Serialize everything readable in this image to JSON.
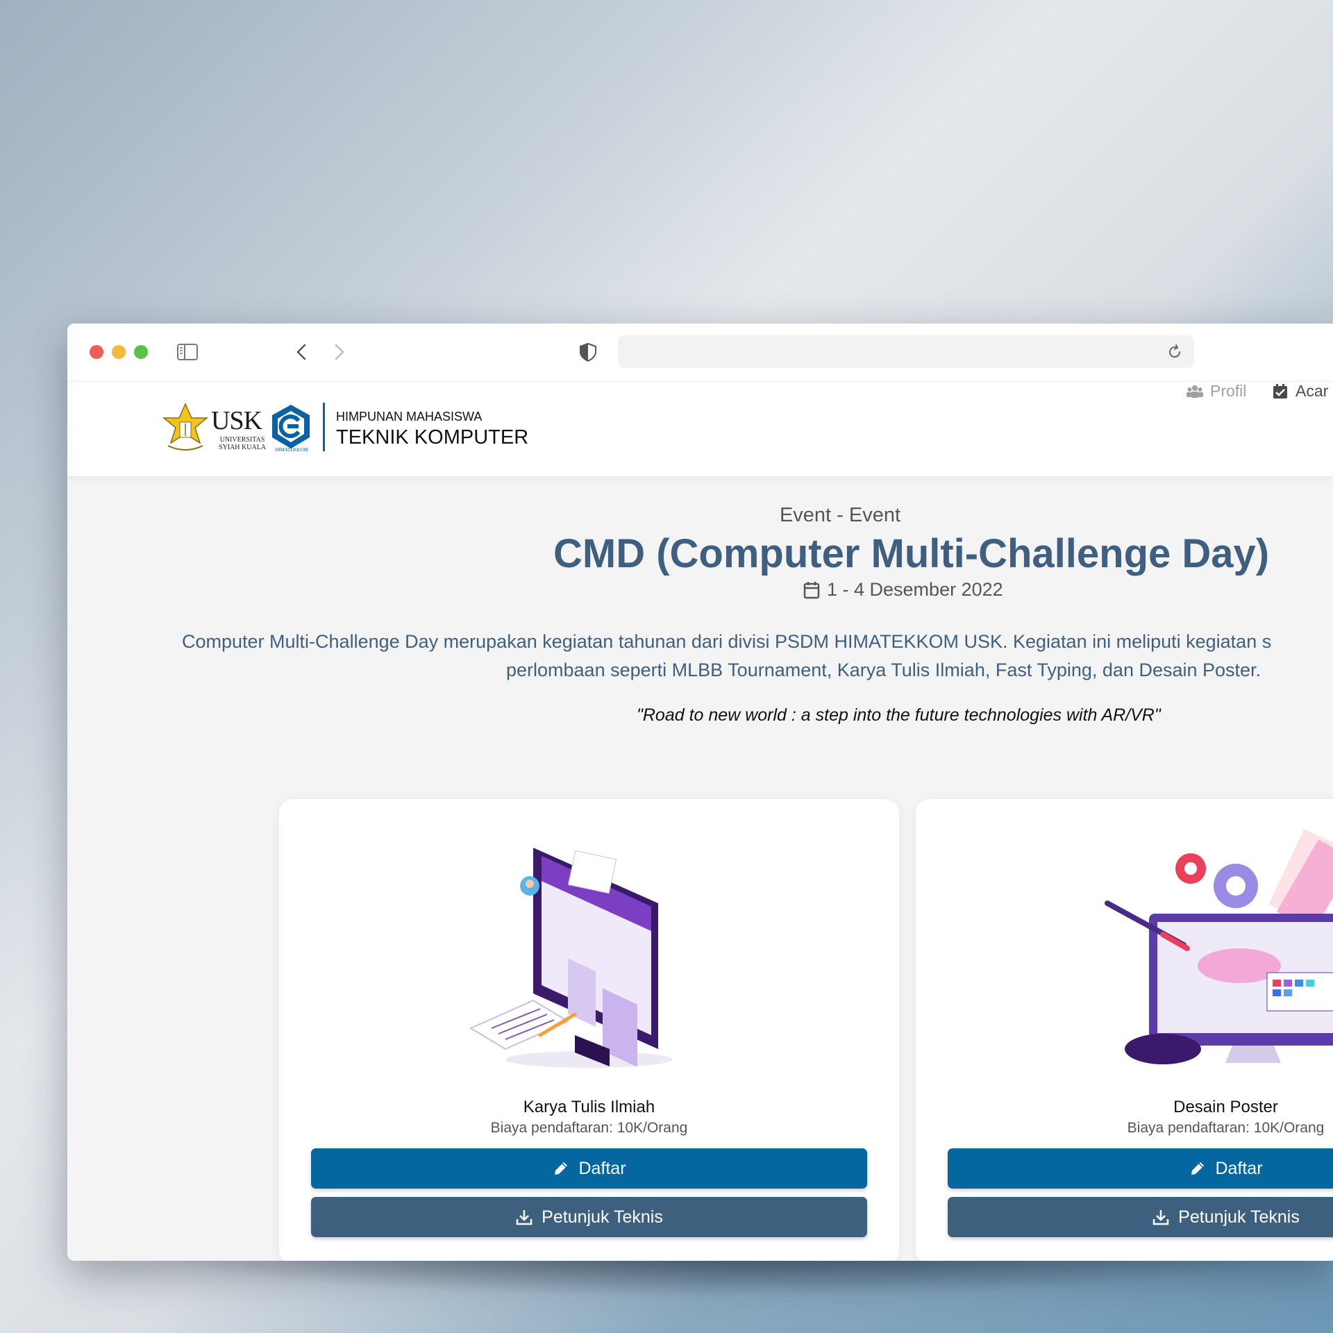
{
  "header": {
    "org_line1": "HIMPUNAN MAHASISWA",
    "org_line2": "TEKNIK KOMPUTER",
    "usk_text": "USK",
    "usk_sub": "UNIVERSITAS SYIAH KUALA",
    "hima_sub": "HIMATEKKOM",
    "nav": [
      {
        "label": "Profil",
        "icon": "users-icon"
      },
      {
        "label": "Acar",
        "icon": "calendar-check-icon"
      }
    ]
  },
  "page": {
    "eyebrow": "Event - Event",
    "title": "CMD (Computer Multi-Challenge Day)",
    "date": "1 - 4 Desember 2022",
    "description_line1": "Computer Multi-Challenge Day merupakan kegiatan tahunan dari divisi PSDM HIMATEKKOM USK. Kegiatan ini meliputi kegiatan s",
    "description_line2": "perlombaan seperti MLBB Tournament, Karya Tulis Ilmiah, Fast Typing, dan Desain Poster.",
    "quote": "\"Road to new world : a step into the future technologies with AR/VR\""
  },
  "cards": [
    {
      "title": "Karya Tulis Ilmiah",
      "fee": "Biaya pendaftaran: 10K/Orang",
      "register_label": "Daftar",
      "guide_label": "Petunjuk Teknis"
    },
    {
      "title": "Desain Poster",
      "fee": "Biaya pendaftaran: 10K/Orang",
      "register_label": "Daftar",
      "guide_label": "Petunjuk Teknis"
    }
  ],
  "colors": {
    "primary_button": "#04679f",
    "secondary_button": "#3e607f",
    "title_color": "#3e5f7f",
    "brand_blue": "#0a62a3"
  }
}
